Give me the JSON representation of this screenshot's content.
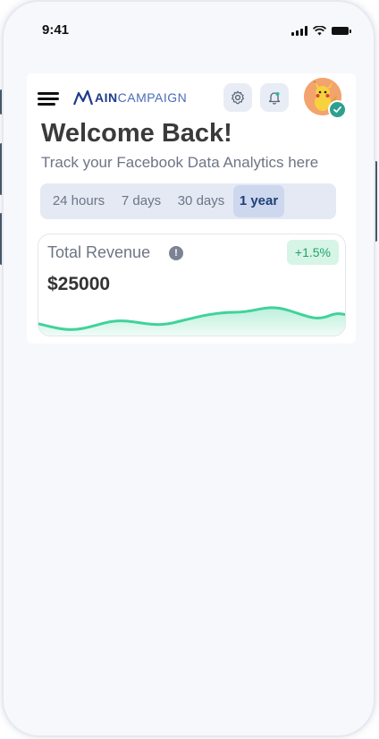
{
  "status_bar": {
    "time": "9:41"
  },
  "header": {
    "logo_bold": "AIN",
    "logo_light": "CAMPAIGN"
  },
  "welcome": {
    "title": "Welcome Back!",
    "subtitle": "Track your Facebook Data Analytics here"
  },
  "tabs": [
    {
      "label": "24 hours",
      "active": false
    },
    {
      "label": "7 days",
      "active": false
    },
    {
      "label": "30 days",
      "active": false
    },
    {
      "label": "1 year",
      "active": true
    }
  ],
  "revenue": {
    "title": "Total Revenue",
    "amount": "$25000",
    "change": "+1.5%",
    "info_glyph": "!"
  },
  "colors": {
    "accent": "#1f3e77",
    "positive": "#23a36a",
    "sparkline": "#3fd39a",
    "verified": "#2f9f8f"
  },
  "icons": [
    "hamburger-menu-icon",
    "mountain-logo-icon",
    "settings-gear-icon",
    "notification-bell-icon",
    "verified-check-icon",
    "info-icon"
  ]
}
